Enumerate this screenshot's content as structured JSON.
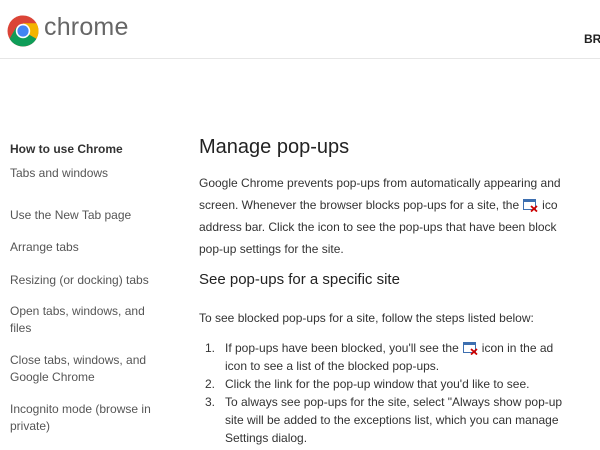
{
  "header": {
    "brand": "chrome",
    "right_text": "BR",
    "logo_icon": "chrome-logo-icon"
  },
  "sidebar": {
    "title": "How to use Chrome",
    "items": [
      {
        "label": "Tabs and windows"
      },
      {
        "label": "Use the New Tab page"
      },
      {
        "label": "Arrange tabs"
      },
      {
        "label": "Resizing (or docking) tabs"
      },
      {
        "label": "Open tabs, windows, and files"
      },
      {
        "label": "Close tabs, windows, and Google Chrome"
      },
      {
        "label": "Incognito mode (browse in private)"
      }
    ]
  },
  "main": {
    "title": "Manage pop-ups",
    "intro_lines": [
      {
        "before": "Google Chrome prevents pop-ups from automatically appearing and",
        "after": ""
      },
      {
        "before": "screen. Whenever the browser blocks pop-ups for a site, the",
        "after": "ico"
      },
      {
        "before": "address bar. Click the icon to see the pop-ups that have been block",
        "after": ""
      },
      {
        "before": "pop-up settings for the site.",
        "after": ""
      }
    ],
    "subtitle": "See pop-ups for a specific site",
    "steps_intro": "To see blocked pop-ups for a site, follow the steps listed below:",
    "steps": [
      {
        "num": "1.",
        "lines": [
          "If pop-ups have been blocked, you'll see the",
          "icon in the ad",
          "icon to see a list of the blocked pop-ups."
        ]
      },
      {
        "num": "2.",
        "lines": [
          "Click the link for the pop-up window that you'd like to see."
        ]
      },
      {
        "num": "3.",
        "lines": [
          "To always see pop-ups for the site, select \"Always show pop-up",
          "site will be added to the exceptions list, which you can manage",
          "Settings dialog."
        ]
      }
    ]
  },
  "colors": {
    "brand_text": "#666666",
    "body_text": "#333333",
    "heading_text": "#222222",
    "popup_x": "#cc0000",
    "popup_window": "#3d6fb0"
  }
}
